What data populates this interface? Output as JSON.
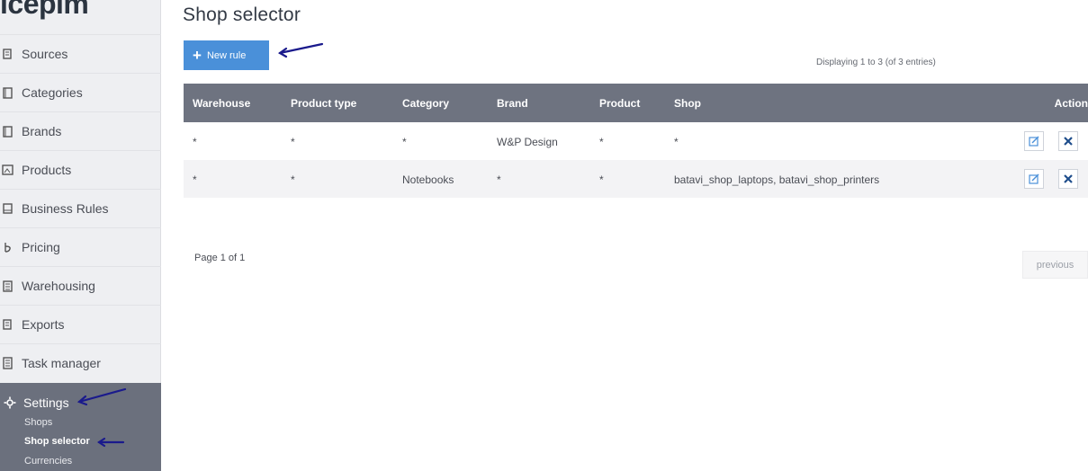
{
  "app": {
    "logo_text": "icepim"
  },
  "sidebar": {
    "items": [
      {
        "label": "Sources",
        "icon": "sources-icon"
      },
      {
        "label": "Categories",
        "icon": "categories-icon"
      },
      {
        "label": "Brands",
        "icon": "brands-icon"
      },
      {
        "label": "Products",
        "icon": "products-icon"
      },
      {
        "label": "Business Rules",
        "icon": "business-rules-icon"
      },
      {
        "label": "Pricing",
        "icon": "pricing-icon"
      },
      {
        "label": "Warehousing",
        "icon": "warehousing-icon"
      },
      {
        "label": "Exports",
        "icon": "exports-icon"
      },
      {
        "label": "Task manager",
        "icon": "task-manager-icon"
      }
    ],
    "settings": {
      "label": "Settings",
      "icon": "gear-icon",
      "subitems": [
        "Shops",
        "Shop selector",
        "Currencies"
      ],
      "active_subitem": "Shop selector"
    }
  },
  "page": {
    "title": "Shop selector",
    "new_rule_label": "New rule",
    "display_info": "Displaying 1 to 3 (of 3 entries)",
    "page_info": "Page 1 of 1",
    "previous_label": "previous"
  },
  "table": {
    "columns": [
      "Warehouse",
      "Product type",
      "Category",
      "Brand",
      "Product",
      "Shop",
      "Action"
    ],
    "rows": [
      [
        "*",
        "*",
        "*",
        "W&P Design",
        "*",
        "*"
      ],
      [
        "*",
        "*",
        "Notebooks",
        "*",
        "*",
        "batavi_shop_laptops, batavi_shop_printers"
      ]
    ]
  },
  "colors": {
    "accent": "#4a90d9",
    "header": "#6e7380",
    "settings_bg": "#6b707d",
    "annotation_arrow": "#1a1a8c"
  }
}
